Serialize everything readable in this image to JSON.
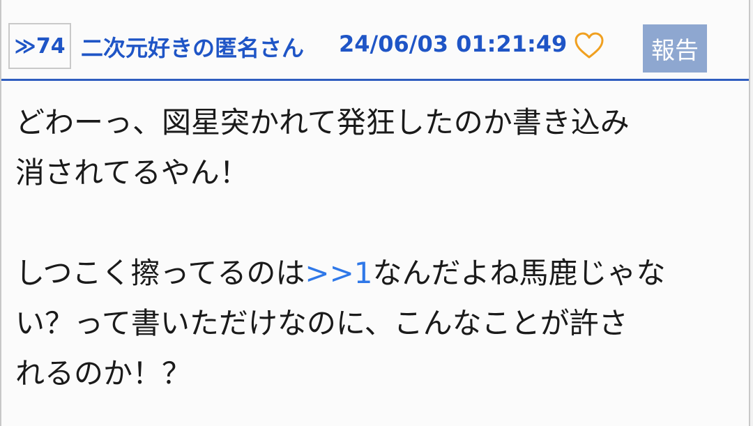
{
  "post": {
    "number_label": "≫74",
    "author": "二次元好きの匿名さん",
    "datetime": "24/06/03 01:21:49",
    "report_label": "報告",
    "like_icon": "heart-outline-icon",
    "colors": {
      "header_text": "#1f55c6",
      "report_bg": "#8ea7d0",
      "heart": "#f0a020",
      "anchor": "#2f78e8",
      "divider": "#2f5dbf"
    },
    "body": {
      "line1": "どわーっ、図星突かれて発狂したのか書き込み",
      "line2": "消されてるやん！",
      "line3_pre": "しつこく擦ってるのは",
      "line3_anchor": ">>1",
      "line3_post": "なんだよね馬鹿じゃな",
      "line4": "い？って書いただけなのに、こんなことが許さ",
      "line5": "れるのか！？"
    }
  }
}
